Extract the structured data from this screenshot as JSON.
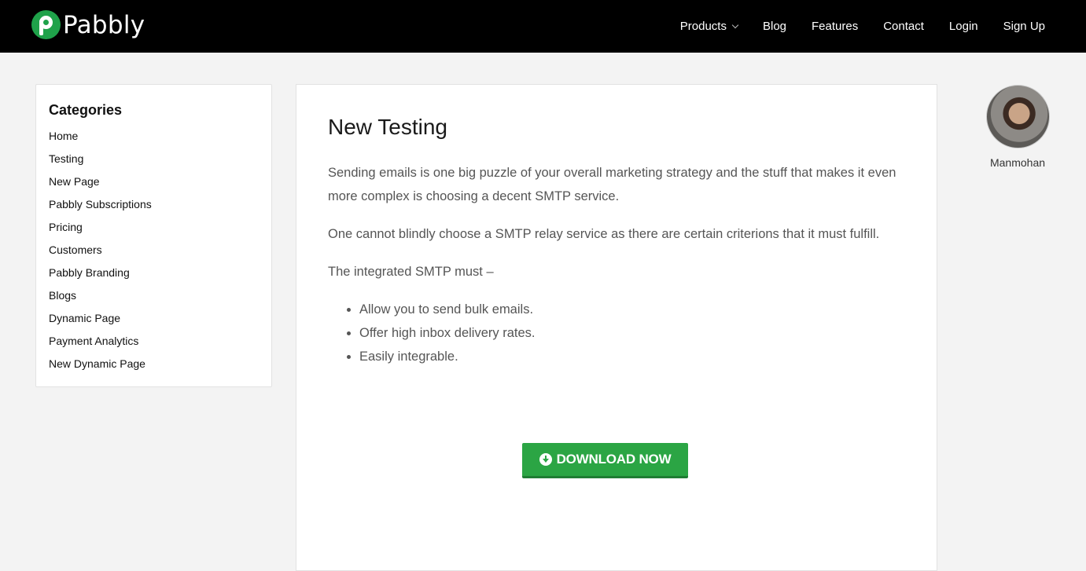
{
  "brand": {
    "name": "Pabbly",
    "color": "#1fa24a"
  },
  "nav": {
    "items": [
      "Products",
      "Blog",
      "Features",
      "Contact",
      "Login",
      "Sign Up"
    ]
  },
  "sidebar": {
    "title": "Categories",
    "items": [
      "Home",
      "Testing",
      "New Page",
      "Pabbly Subscriptions",
      "Pricing",
      "Customers",
      "Pabbly Branding",
      "Blogs",
      "Dynamic Page",
      "Payment Analytics",
      "New Dynamic Page"
    ]
  },
  "article": {
    "title": "New Testing",
    "paragraphs": [
      "Sending emails is one big puzzle of your overall marketing strategy and the stuff that makes it even more complex is choosing a decent SMTP service.",
      "One cannot blindly choose a SMTP relay service as there are certain criterions that it must fulfill.",
      "The integrated SMTP must –"
    ],
    "bullets": [
      "Allow you to send bulk emails.",
      "Offer high inbox delivery rates.",
      "Easily integrable."
    ],
    "download_label": "DOWNLOAD NOW"
  },
  "author": {
    "name": "Manmohan"
  }
}
